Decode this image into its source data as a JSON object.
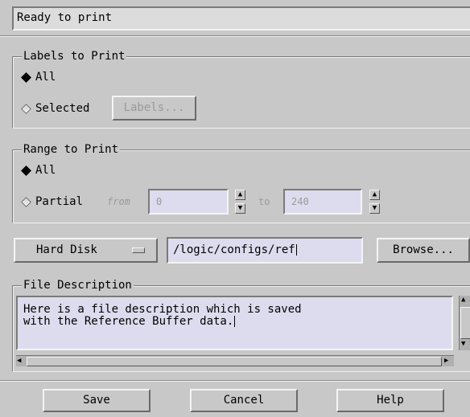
{
  "status": {
    "text": "Ready to print"
  },
  "labels_to_print": {
    "legend": "Labels to Print",
    "all_label": "All",
    "selected_label": "Selected",
    "labels_button": "Labels...",
    "selection": "All"
  },
  "range_to_print": {
    "legend": "Range to Print",
    "all_label": "All",
    "partial_label": "Partial",
    "from_label": "from",
    "from_value": "0",
    "to_label": "to",
    "to_value": "240",
    "selection": "All"
  },
  "destination": {
    "device": "Hard Disk",
    "path": "/logic/configs/ref",
    "browse_label": "Browse..."
  },
  "file_description": {
    "legend": "File Description",
    "line1": "Here is a file description which is saved",
    "line2": "with the Reference Buffer data."
  },
  "footer": {
    "save_label": "Save",
    "cancel_label": "Cancel",
    "help_label": "Help"
  },
  "icons": {
    "spin_up": "triangle-up",
    "spin_down": "triangle-down",
    "device_menu": "option-menu-bar"
  }
}
